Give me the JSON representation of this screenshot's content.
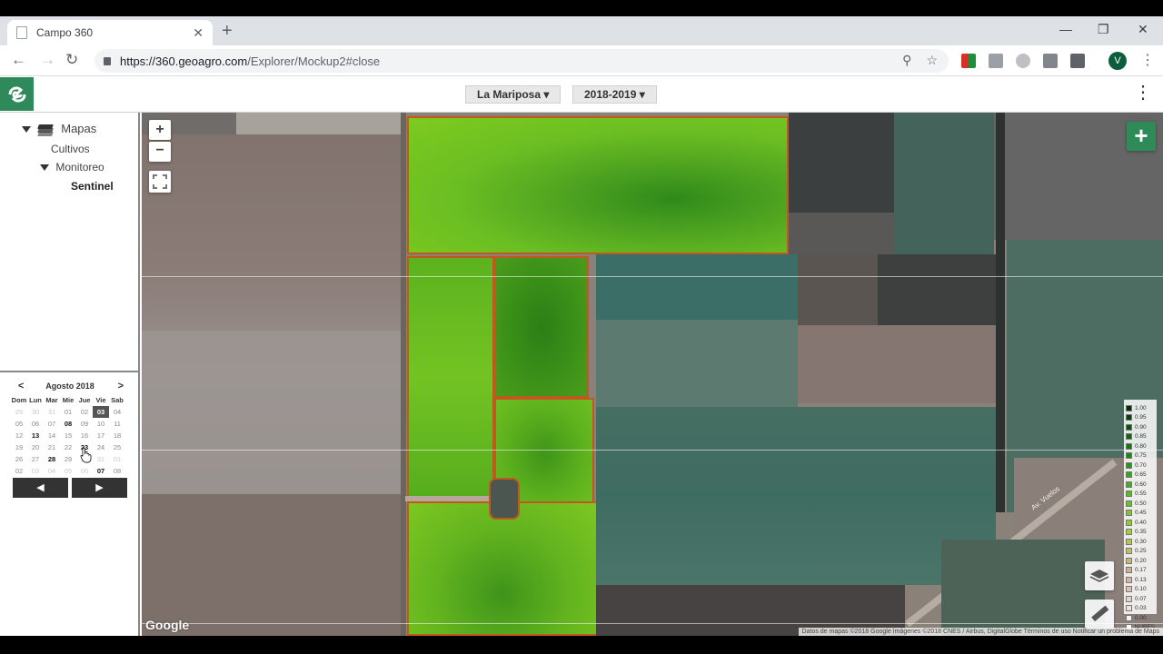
{
  "browser": {
    "tab_title": "Campo 360",
    "tab_close": "✕",
    "new_tab": "+",
    "url_host": "https://360.geoagro.com",
    "url_path": "/Explorer/Mockup2#close",
    "profile_initial": "V",
    "window_controls": {
      "minimize": "—",
      "restore": "❐",
      "close": "✕"
    }
  },
  "app": {
    "field_dropdown": "La Mariposa",
    "season_dropdown": "2018-2019",
    "menu_icon": "⋮"
  },
  "sidebar": {
    "tree": {
      "mapas": "Mapas",
      "cultivos": "Cultivos",
      "monitoreo": "Monitoreo",
      "sentinel": "Sentinel"
    },
    "calendar": {
      "month": "Agosto 2018",
      "prev": "<",
      "next": ">",
      "weekdays": [
        "Dom",
        "Lun",
        "Mar",
        "Mie",
        "Jue",
        "Vie",
        "Sab"
      ],
      "weeks": [
        [
          {
            "d": "29",
            "s": "muted"
          },
          {
            "d": "30",
            "s": "muted"
          },
          {
            "d": "31",
            "s": "muted"
          },
          {
            "d": "01",
            "s": ""
          },
          {
            "d": "02",
            "s": ""
          },
          {
            "d": "03",
            "s": "sel"
          },
          {
            "d": "04",
            "s": ""
          }
        ],
        [
          {
            "d": "05",
            "s": ""
          },
          {
            "d": "06",
            "s": ""
          },
          {
            "d": "07",
            "s": ""
          },
          {
            "d": "08",
            "s": "bold"
          },
          {
            "d": "09",
            "s": ""
          },
          {
            "d": "10",
            "s": ""
          },
          {
            "d": "11",
            "s": ""
          }
        ],
        [
          {
            "d": "12",
            "s": ""
          },
          {
            "d": "13",
            "s": "bold"
          },
          {
            "d": "14",
            "s": ""
          },
          {
            "d": "15",
            "s": ""
          },
          {
            "d": "16",
            "s": ""
          },
          {
            "d": "17",
            "s": ""
          },
          {
            "d": "18",
            "s": ""
          }
        ],
        [
          {
            "d": "19",
            "s": ""
          },
          {
            "d": "20",
            "s": ""
          },
          {
            "d": "21",
            "s": ""
          },
          {
            "d": "22",
            "s": ""
          },
          {
            "d": "23",
            "s": "bold"
          },
          {
            "d": "24",
            "s": ""
          },
          {
            "d": "25",
            "s": ""
          }
        ],
        [
          {
            "d": "26",
            "s": ""
          },
          {
            "d": "27",
            "s": ""
          },
          {
            "d": "28",
            "s": "bold"
          },
          {
            "d": "29",
            "s": ""
          },
          {
            "d": "30",
            "s": "muted"
          },
          {
            "d": "31",
            "s": "muted"
          },
          {
            "d": "01",
            "s": "muted"
          }
        ],
        [
          {
            "d": "02",
            "s": ""
          },
          {
            "d": "03",
            "s": "muted"
          },
          {
            "d": "04",
            "s": "muted"
          },
          {
            "d": "05",
            "s": "muted"
          },
          {
            "d": "06",
            "s": "muted"
          },
          {
            "d": "07",
            "s": "bold"
          },
          {
            "d": "08",
            "s": ""
          }
        ]
      ],
      "prev_button": "◀",
      "next_button": "▶"
    }
  },
  "map": {
    "zoom_in": "+",
    "zoom_out": "−",
    "add_button": "+",
    "google": "Google",
    "road_label": "Av. Vuelos",
    "attribution": "Datos de mapas ©2018 Google Imágenes ©2018 CNES / Airbus, DigitalGlobe   Términos de uso   Notificar un problema de Maps",
    "legend": [
      "1.00",
      "0.95",
      "0.90",
      "0.85",
      "0.80",
      "0.75",
      "0.70",
      "0.65",
      "0.60",
      "0.55",
      "0.50",
      "0.45",
      "0.40",
      "0.35",
      "0.30",
      "0.25",
      "0.20",
      "0.17",
      "0.13",
      "0.10",
      "0.07",
      "0.03",
      "0.00",
      "NUBES"
    ],
    "legend_colors": [
      "#0b2a0b",
      "#0f3b10",
      "#144d14",
      "#1a5e17",
      "#20701b",
      "#27801f",
      "#2f9023",
      "#3b9e28",
      "#4aa92c",
      "#5bb32f",
      "#6dbc33",
      "#80c437",
      "#92c93b",
      "#a3ca4a",
      "#b1c65c",
      "#bcbf6e",
      "#c5b780",
      "#cbb093",
      "#d2b7a4",
      "#dac4b7",
      "#e3d3c9",
      "#ece2db",
      "#f6f1ee",
      "#ffffff"
    ]
  }
}
